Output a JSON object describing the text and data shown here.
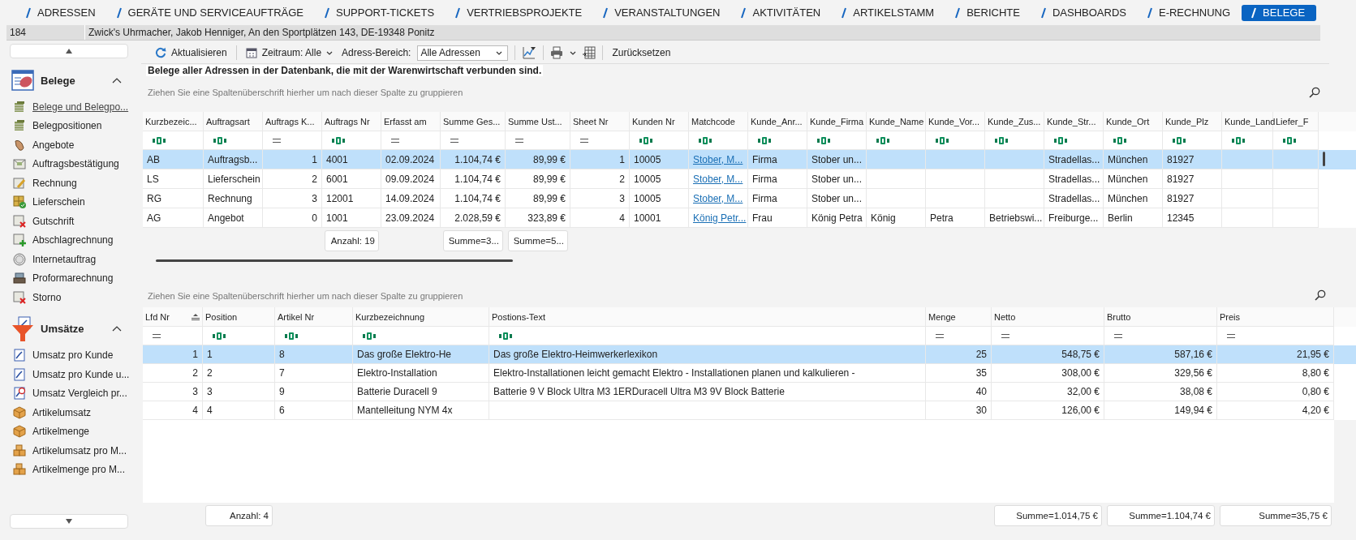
{
  "tabs": [
    {
      "label": "ADRESSEN",
      "selected": false
    },
    {
      "label": "GERÄTE UND SERVICEAUFTRÄGE",
      "selected": false
    },
    {
      "label": "SUPPORT-TICKETS",
      "selected": false
    },
    {
      "label": "VERTRIEBSPROJEKTE",
      "selected": false
    },
    {
      "label": "VERANSTALTUNGEN",
      "selected": false
    },
    {
      "label": "AKTIVITÄTEN",
      "selected": false
    },
    {
      "label": "ARTIKELSTAMM",
      "selected": false
    },
    {
      "label": "BERICHTE",
      "selected": false
    },
    {
      "label": "DASHBOARDS",
      "selected": false
    },
    {
      "label": "E-RECHNUNG",
      "selected": false
    },
    {
      "label": "BELEGE",
      "selected": true
    }
  ],
  "address_bar": {
    "number": "184",
    "address": "Zwick's Uhrmacher, Jakob Henniger, An den Sportplätzen 143, DE-19348 Ponitz"
  },
  "sidebar": {
    "groups": [
      {
        "title": "Belege",
        "expanded": true,
        "items": [
          {
            "label": "Belege und Belegpo...",
            "selected": true
          },
          {
            "label": "Belegpositionen",
            "selected": false
          },
          {
            "label": "Angebote",
            "selected": false
          },
          {
            "label": "Auftragsbestätigung",
            "selected": false
          },
          {
            "label": "Rechnung",
            "selected": false
          },
          {
            "label": "Lieferschein",
            "selected": false
          },
          {
            "label": "Gutschrift",
            "selected": false
          },
          {
            "label": "Abschlagrechnung",
            "selected": false
          },
          {
            "label": "Internetauftrag",
            "selected": false
          },
          {
            "label": "Proformarechnung",
            "selected": false
          },
          {
            "label": "Storno",
            "selected": false
          }
        ]
      },
      {
        "title": "Umsätze",
        "expanded": true,
        "items": [
          {
            "label": "Umsatz pro Kunde",
            "selected": false
          },
          {
            "label": "Umsatz pro Kunde u...",
            "selected": false
          },
          {
            "label": "Umsatz Vergleich pr...",
            "selected": false
          },
          {
            "label": "Artikelumsatz",
            "selected": false
          },
          {
            "label": "Artikelmenge",
            "selected": false
          },
          {
            "label": "Artikelumsatz pro M...",
            "selected": false
          },
          {
            "label": "Artikelmenge pro M...",
            "selected": false
          }
        ]
      }
    ]
  },
  "toolbar": {
    "refresh": "Aktualisieren",
    "period": "Zeitraum: Alle",
    "range_label": "Adress-Bereich:",
    "range_value": "Alle Adressen",
    "reset": "Zurücksetzen"
  },
  "caption": "Belege aller Adressen in der Datenbank, die mit der Warenwirtschaft verbunden sind.",
  "upper_grid": {
    "group_hint": "Ziehen Sie eine Spaltenüberschrift hierher um nach dieser Spalte zu gruppieren",
    "columns": [
      {
        "label": "Kurzbezeic...",
        "kind": "text"
      },
      {
        "label": "Auftragsart",
        "kind": "text"
      },
      {
        "label": "Auftrags K...",
        "kind": "number"
      },
      {
        "label": "Auftrags Nr",
        "kind": "text",
        "summary": "Anzahl: 19"
      },
      {
        "label": "Erfasst am",
        "kind": "date"
      },
      {
        "label": "Summe Ges...",
        "kind": "number",
        "summary": "Summe=3..."
      },
      {
        "label": "Summe Ust...",
        "kind": "number",
        "summary": "Summe=5..."
      },
      {
        "label": "Sheet Nr",
        "kind": "number"
      },
      {
        "label": "Kunden Nr",
        "kind": "text"
      },
      {
        "label": "Matchcode",
        "kind": "link"
      },
      {
        "label": "Kunde_Anr...",
        "kind": "text"
      },
      {
        "label": "Kunde_Firma",
        "kind": "text"
      },
      {
        "label": "Kunde_Name",
        "kind": "text"
      },
      {
        "label": "Kunde_Vor...",
        "kind": "text"
      },
      {
        "label": "Kunde_Zus...",
        "kind": "text"
      },
      {
        "label": "Kunde_Str...",
        "kind": "text"
      },
      {
        "label": "Kunde_Ort",
        "kind": "text"
      },
      {
        "label": "Kunde_Plz",
        "kind": "text"
      },
      {
        "label": "Kunde_Land",
        "kind": "text"
      },
      {
        "label": "Liefer_F",
        "kind": "text"
      }
    ],
    "rows": [
      {
        "selected": true,
        "cells": [
          "AB",
          "Auftragsb...",
          "1",
          "4001",
          "02.09.2024",
          "1.104,74 €",
          "89,99 €",
          "1",
          "10005",
          "Stober, M...",
          "Firma",
          "Stober un...",
          null,
          null,
          null,
          "Stradellas...",
          "München",
          "81927",
          null,
          null
        ]
      },
      {
        "selected": false,
        "cells": [
          "LS",
          "Lieferschein",
          "2",
          "6001",
          "09.09.2024",
          "1.104,74 €",
          "89,99 €",
          "2",
          "10005",
          "Stober, M...",
          "Firma",
          "Stober un...",
          null,
          null,
          null,
          "Stradellas...",
          "München",
          "81927",
          null,
          null
        ]
      },
      {
        "selected": false,
        "cells": [
          "RG",
          "Rechnung",
          "3",
          "12001",
          "14.09.2024",
          "1.104,74 €",
          "89,99 €",
          "3",
          "10005",
          "Stober, M...",
          "Firma",
          "Stober un...",
          null,
          null,
          null,
          "Stradellas...",
          "München",
          "81927",
          null,
          null
        ]
      },
      {
        "selected": false,
        "cells": [
          "AG",
          "Angebot",
          "0",
          "1001",
          "23.09.2024",
          "2.028,59 €",
          "323,89 €",
          "4",
          "10001",
          "König Petr...",
          "Frau",
          "König Petra",
          "König",
          "Petra",
          "Betriebswi...",
          "Freiburge...",
          "Berlin",
          "12345",
          null,
          null
        ]
      }
    ]
  },
  "lower_grid": {
    "group_hint": "Ziehen Sie eine Spaltenüberschrift hierher um nach dieser Spalte zu gruppieren",
    "columns": [
      {
        "label": "Lfd Nr",
        "kind": "number",
        "sorted": true
      },
      {
        "label": "Position",
        "kind": "text",
        "sorted": false,
        "summary": "Anzahl: 4"
      },
      {
        "label": "Artikel Nr",
        "kind": "text",
        "sorted": false
      },
      {
        "label": "Kurzbezeichnung",
        "kind": "text",
        "sorted": false
      },
      {
        "label": "Postions-Text",
        "kind": "text",
        "sorted": false
      },
      {
        "label": "Menge",
        "kind": "number",
        "sorted": false
      },
      {
        "label": "Netto",
        "kind": "number",
        "sorted": false,
        "summary": "Summe=1.014,75 €"
      },
      {
        "label": "Brutto",
        "kind": "number",
        "sorted": false,
        "summary": "Summe=1.104,74 €"
      },
      {
        "label": "Preis",
        "kind": "number",
        "sorted": false,
        "summary": "Summe=35,75 €"
      }
    ],
    "rows": [
      {
        "selected": true,
        "cells": [
          "1",
          "1",
          "8",
          "Das große Elektro-He",
          "Das große Elektro-Heimwerkerlexikon",
          "25",
          "548,75 €",
          "587,16 €",
          "21,95 €"
        ]
      },
      {
        "selected": false,
        "cells": [
          "2",
          "2",
          "7",
          "Elektro-Installation",
          "Elektro-Installationen leicht gemacht Elektro - Installationen planen und kalkulieren -",
          "35",
          "308,00 €",
          "329,56 €",
          "8,80 €"
        ]
      },
      {
        "selected": false,
        "cells": [
          "3",
          "3",
          "9",
          "Batterie Duracell 9",
          "Batterie 9 V Block Ultra M3 1ERDuracell Ultra M3 9V Block Batterie",
          "40",
          "32,00 €",
          "38,08 €",
          "0,80 €"
        ]
      },
      {
        "selected": false,
        "cells": [
          "4",
          "4",
          "6",
          "Mantelleitung NYM 4x",
          null,
          "30",
          "126,00 €",
          "149,94 €",
          "4,20 €"
        ]
      }
    ]
  }
}
